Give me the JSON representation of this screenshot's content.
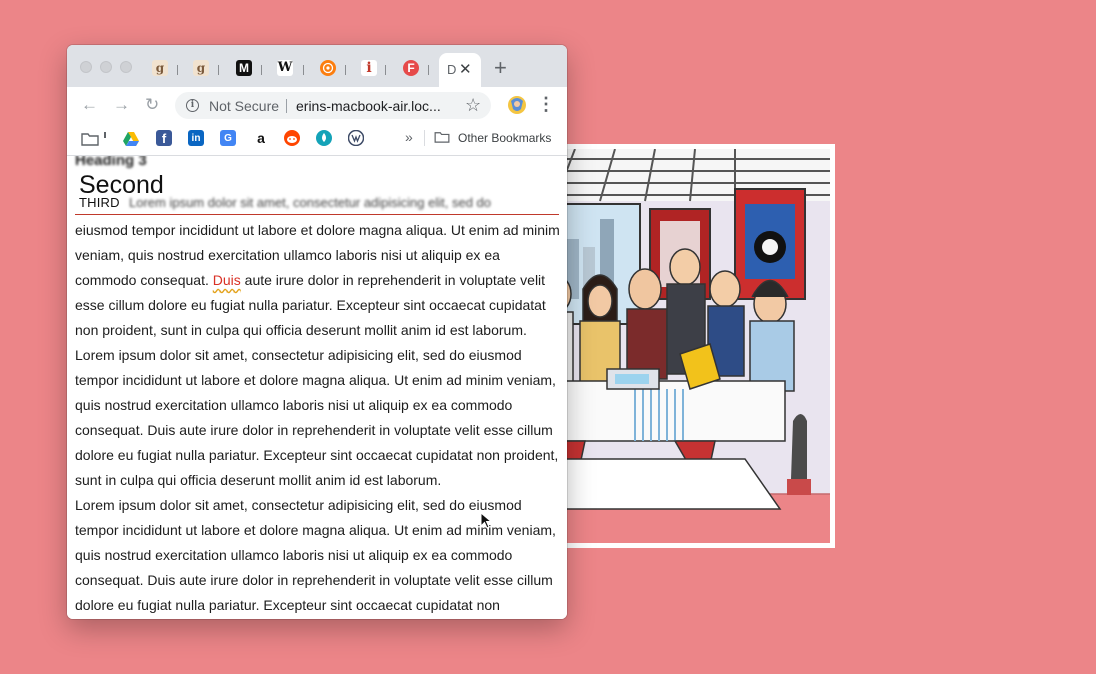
{
  "browser": {
    "tabs": [
      {
        "icon": "g",
        "kind": "goodreads"
      },
      {
        "icon": "g",
        "kind": "goodreads"
      },
      {
        "icon": "M",
        "kind": "medium"
      },
      {
        "icon": "W",
        "kind": "wikipedia"
      },
      {
        "icon": "podcast",
        "kind": "overcast"
      },
      {
        "icon": "i",
        "kind": "instapaper"
      },
      {
        "icon": "F",
        "kind": "f-site"
      }
    ],
    "active_tab_letter": "D",
    "close_glyph": "✕",
    "new_tab_glyph": "+"
  },
  "toolbar": {
    "back_glyph": "←",
    "forward_glyph": "→",
    "reload_glyph": "↻",
    "security_label": "Not Secure",
    "url": "erins-macbook-air.loc...",
    "star_glyph": "☆",
    "menu_glyph": "⋮"
  },
  "bookmarks": {
    "items": [
      "folder-icon",
      "google-drive-icon",
      "facebook-icon",
      "linkedin-icon",
      "google-translate-icon",
      "amazon-icon",
      "reddit-icon",
      "drop-icon",
      "volkswagen-icon"
    ],
    "overflow_glyph": "»",
    "other_label": "Other Bookmarks"
  },
  "page": {
    "heading3": "Heading 3",
    "second": "Second",
    "third": "THIRD",
    "blurred_line": "Lorem ipsum dolor sit amet, consectetur adipisicing elit, sed do",
    "p1_start": "eiusmod tempor incididunt ut labore et dolore magna aliqua. Ut enim ad minim veniam, quis nostrud exercitation ullamco laboris nisi ut aliquip ex ea commodo consequat. ",
    "p1_misspelled": "Duis",
    "p1_end": " aute irure dolor in reprehenderit in voluptate velit esse cillum dolore eu fugiat nulla pariatur. Excepteur sint occaecat cupidatat non proident, sunt in culpa qui officia deserunt mollit anim id est laborum.",
    "p2": "Lorem ipsum dolor sit amet, consectetur adipisicing elit, sed do eiusmod tempor incididunt ut labore et dolore magna aliqua. Ut enim ad minim veniam, quis nostrud exercitation ullamco laboris nisi ut aliquip ex ea commodo consequat. Duis aute irure dolor in reprehenderit in voluptate velit esse cillum dolore eu fugiat nulla pariatur. Excepteur sint occaecat cupidatat non proident, sunt in culpa qui officia deserunt mollit anim id est laborum.",
    "p3": "Lorem ipsum dolor sit amet, consectetur adipisicing elit, sed do eiusmod tempor incididunt ut labore et dolore magna aliqua. Ut enim ad minim veniam, quis nostrud exercitation ullamco laboris nisi ut aliquip ex ea commodo consequat. Duis aute irure dolor in reprehenderit in voluptate velit esse cillum dolore eu fugiat nulla pariatur. Excepteur sint occaecat cupidatat non"
  },
  "colors": {
    "background": "#ec8588",
    "accent_rule": "#c0392b",
    "misspelled": "#d93025"
  }
}
